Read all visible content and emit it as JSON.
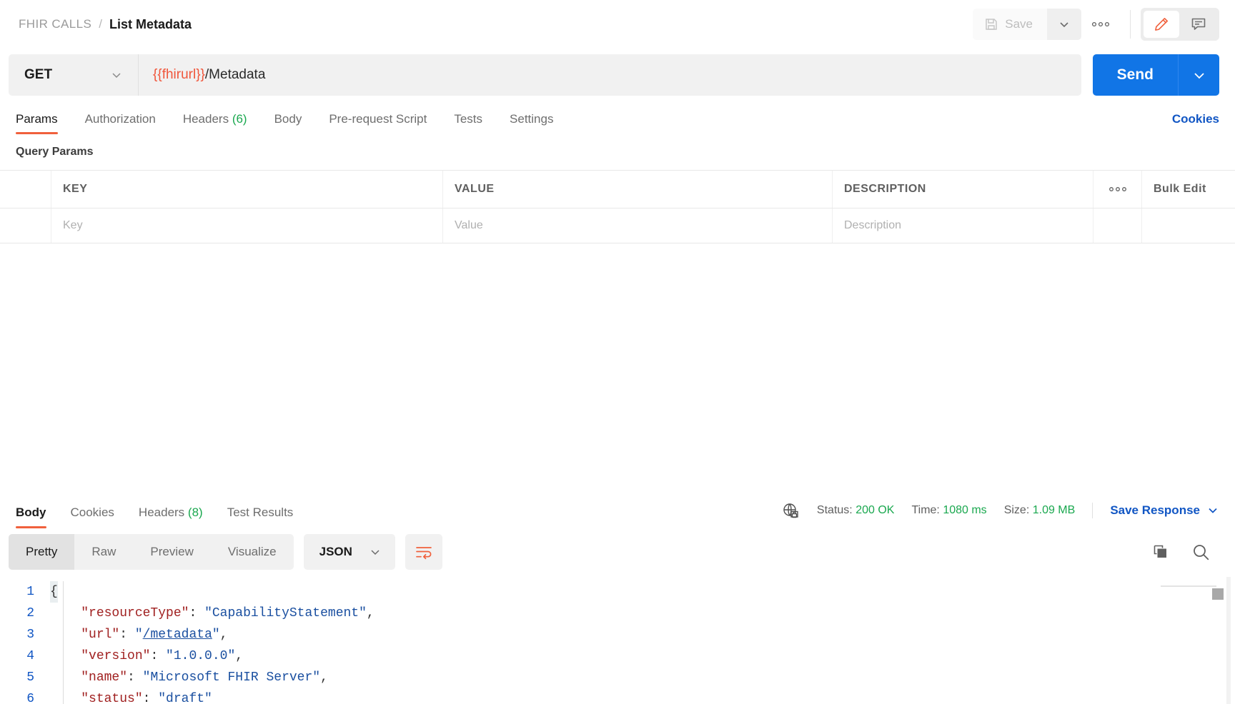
{
  "breadcrumb": {
    "collection": "FHIR CALLS",
    "separator": "/",
    "request_name": "List Metadata"
  },
  "topbar": {
    "save_label": "Save",
    "save_caret_icon": "chevron-down-icon",
    "more_icon": "ellipsis-icon",
    "edit_icon": "pencil-icon",
    "comment_icon": "comment-icon"
  },
  "request": {
    "method": "GET",
    "method_caret_icon": "chevron-down-icon",
    "url_variable": "{{fhirurl}}",
    "url_path": "/Metadata",
    "send_label": "Send",
    "send_caret_icon": "chevron-down-icon"
  },
  "request_tabs": [
    {
      "label": "Params",
      "count": "",
      "active": true
    },
    {
      "label": "Authorization",
      "count": "",
      "active": false
    },
    {
      "label": "Headers",
      "count": "(6)",
      "active": false
    },
    {
      "label": "Body",
      "count": "",
      "active": false
    },
    {
      "label": "Pre-request Script",
      "count": "",
      "active": false
    },
    {
      "label": "Tests",
      "count": "",
      "active": false
    },
    {
      "label": "Settings",
      "count": "",
      "active": false
    }
  ],
  "cookies_link": "Cookies",
  "query_params": {
    "section_title": "Query Params",
    "headers": {
      "key": "KEY",
      "value": "VALUE",
      "description": "DESCRIPTION",
      "more_icon": "ellipsis-icon",
      "bulk_edit": "Bulk Edit"
    },
    "rows": [
      {
        "key_placeholder": "Key",
        "value_placeholder": "Value",
        "description_placeholder": "Description"
      }
    ]
  },
  "response": {
    "tabs": [
      {
        "label": "Body",
        "count": "",
        "active": true
      },
      {
        "label": "Cookies",
        "count": "",
        "active": false
      },
      {
        "label": "Headers",
        "count": "(8)",
        "active": false
      },
      {
        "label": "Test Results",
        "count": "",
        "active": false
      }
    ],
    "globe_icon": "globe-lock-icon",
    "status_label": "Status:",
    "status_value": "200 OK",
    "time_label": "Time:",
    "time_value": "1080 ms",
    "size_label": "Size:",
    "size_value": "1.09 MB",
    "save_response_label": "Save Response",
    "save_response_caret_icon": "chevron-down-icon",
    "format_tabs": [
      {
        "label": "Pretty",
        "active": true
      },
      {
        "label": "Raw",
        "active": false
      },
      {
        "label": "Preview",
        "active": false
      },
      {
        "label": "Visualize",
        "active": false
      }
    ],
    "language": "JSON",
    "language_caret_icon": "chevron-down-icon",
    "wrap_icon": "word-wrap-icon",
    "copy_icon": "copy-icon",
    "search_icon": "search-icon",
    "body_lines": [
      {
        "num": "1",
        "segments": [
          {
            "t": "{",
            "c": "p"
          }
        ]
      },
      {
        "num": "2",
        "segments": [
          {
            "t": "    ",
            "c": "p"
          },
          {
            "t": "\"resourceType\"",
            "c": "k"
          },
          {
            "t": ": ",
            "c": "p"
          },
          {
            "t": "\"CapabilityStatement\"",
            "c": "s"
          },
          {
            "t": ",",
            "c": "p"
          }
        ]
      },
      {
        "num": "3",
        "segments": [
          {
            "t": "    ",
            "c": "p"
          },
          {
            "t": "\"url\"",
            "c": "k"
          },
          {
            "t": ": ",
            "c": "p"
          },
          {
            "t": "\"",
            "c": "s"
          },
          {
            "t": "/metadata",
            "c": "lnk"
          },
          {
            "t": "\"",
            "c": "s"
          },
          {
            "t": ",",
            "c": "p"
          }
        ]
      },
      {
        "num": "4",
        "segments": [
          {
            "t": "    ",
            "c": "p"
          },
          {
            "t": "\"version\"",
            "c": "k"
          },
          {
            "t": ": ",
            "c": "p"
          },
          {
            "t": "\"1.0.0.0\"",
            "c": "s"
          },
          {
            "t": ",",
            "c": "p"
          }
        ]
      },
      {
        "num": "5",
        "segments": [
          {
            "t": "    ",
            "c": "p"
          },
          {
            "t": "\"name\"",
            "c": "k"
          },
          {
            "t": ": ",
            "c": "p"
          },
          {
            "t": "\"Microsoft FHIR Server\"",
            "c": "s"
          },
          {
            "t": ",",
            "c": "p"
          }
        ]
      },
      {
        "num": "6",
        "segments": [
          {
            "t": "    ",
            "c": "p"
          },
          {
            "t": "\"status\"",
            "c": "k"
          },
          {
            "t": ": ",
            "c": "p"
          },
          {
            "t": "\"draft\"",
            "c": "s"
          }
        ]
      }
    ]
  },
  "colors": {
    "accent_orange": "#f0603c",
    "link_blue": "#1156c4",
    "send_blue": "#1175e6",
    "status_green": "#1aa84f"
  }
}
